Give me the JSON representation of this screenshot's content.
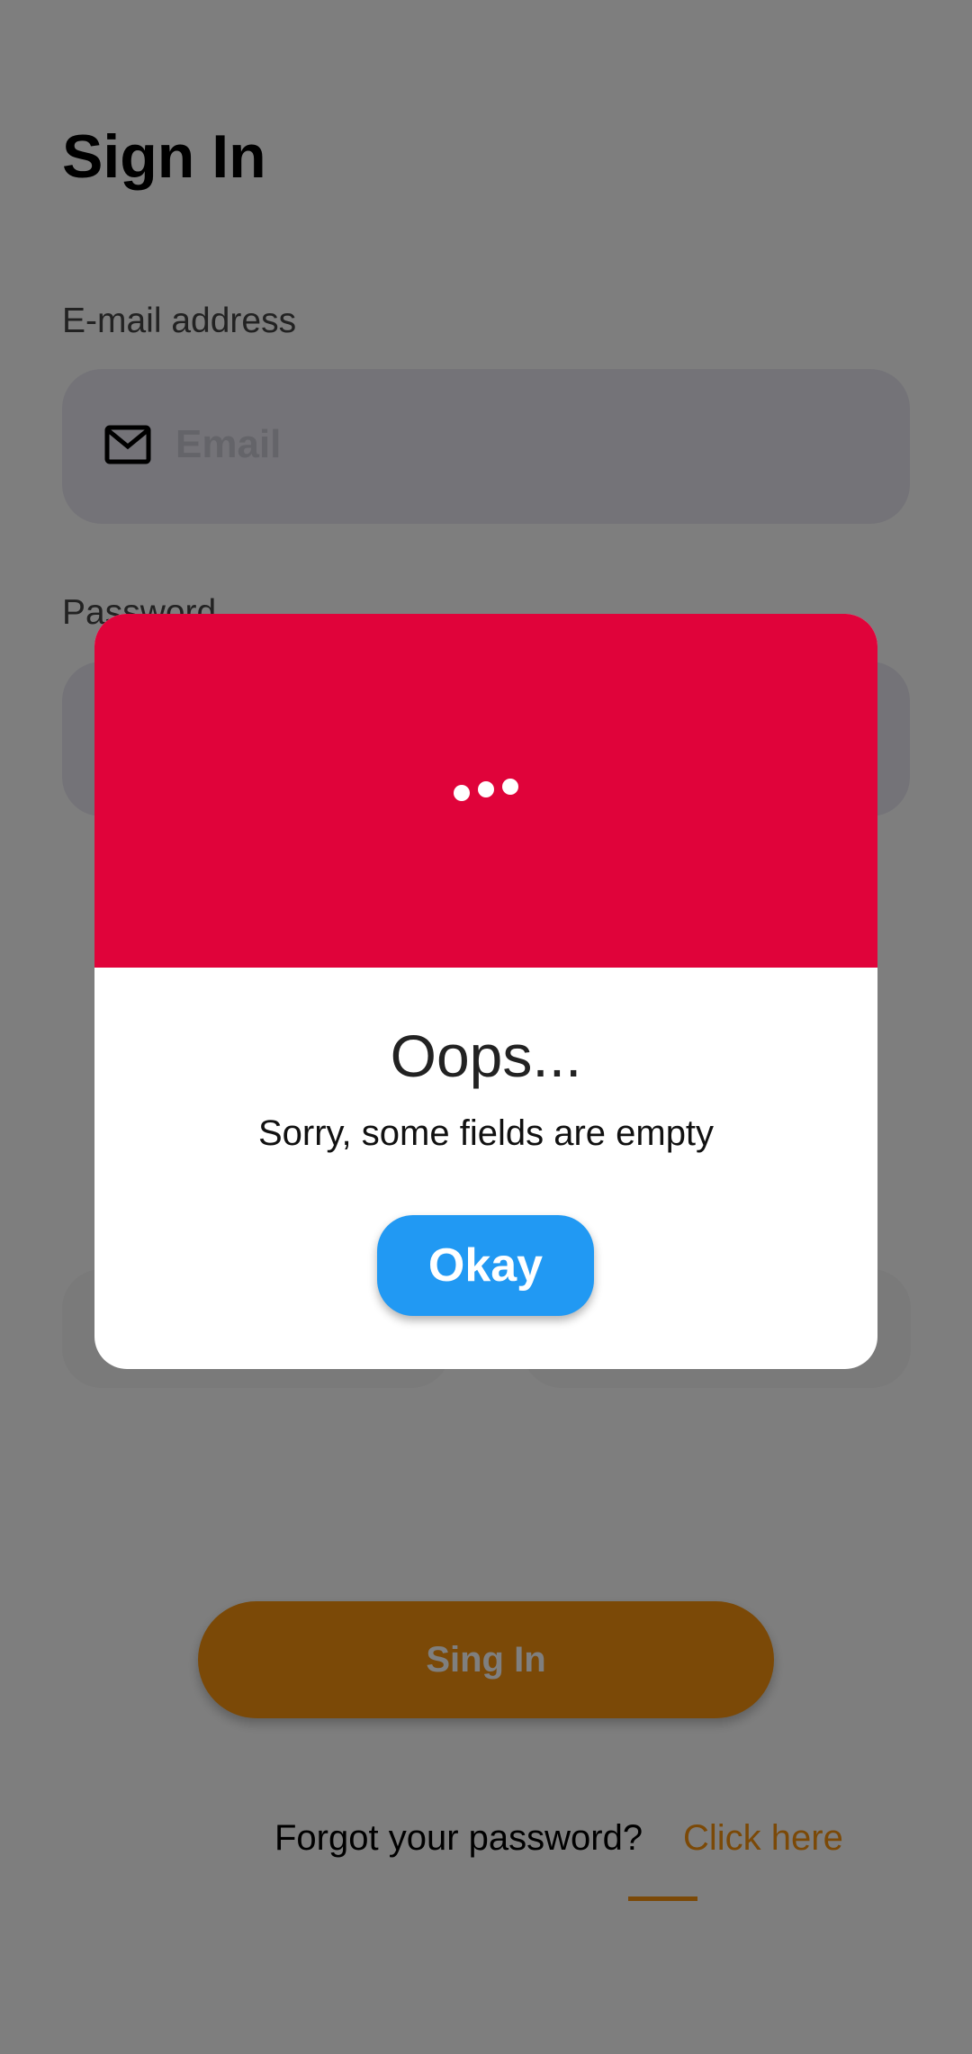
{
  "screen": {
    "title": "Sign In"
  },
  "email": {
    "label": "E-mail address",
    "placeholder": "Email",
    "icon": "mail-icon"
  },
  "password": {
    "label": "Password"
  },
  "signin_button": {
    "label": "Sing In"
  },
  "forgot": {
    "text": "Forgot your password?",
    "link": "Click here"
  },
  "dialog": {
    "title": "Oops...",
    "message": "Sorry, some fields are empty",
    "button": "Okay",
    "header_icon": "loading-dots-icon"
  },
  "colors": {
    "accent": "#f7930e",
    "error": "#e0033a",
    "primary_button": "#2199f3",
    "input_bg": "#e8e7f1"
  }
}
